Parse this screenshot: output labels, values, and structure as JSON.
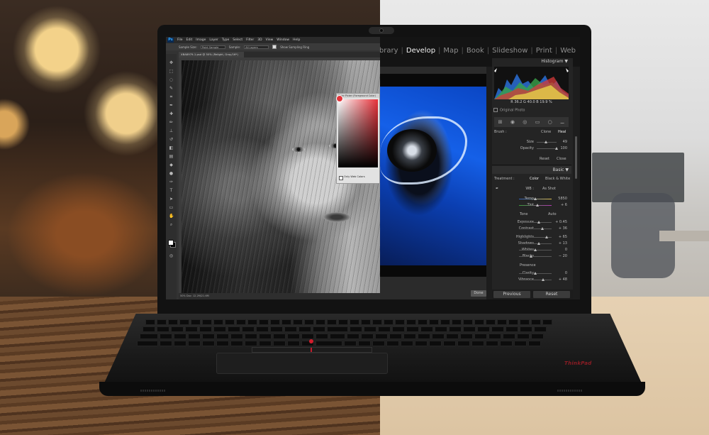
{
  "photoshop": {
    "logo": "Ps",
    "menus": [
      "File",
      "Edit",
      "Image",
      "Layer",
      "Type",
      "Select",
      "Filter",
      "3D",
      "View",
      "Window",
      "Help"
    ],
    "options": {
      "sample_size_label": "Sample Size:",
      "sample_size_value": "Point Sample",
      "sample_label": "Sample:",
      "sample_value": "All Layers",
      "sampling_ring_label": "Show Sampling Ring"
    },
    "document_tab": "XBA8979-1.psd @ 50% (Relight, Gray/16*)",
    "status_text": "50%          Doc: 12.2M/21.6M",
    "color_picker": {
      "title": "Color Picker (Foreground Color)",
      "only_web_colors_label": "Only Web Colors"
    }
  },
  "lightroom": {
    "modules": [
      "Library",
      "Develop",
      "Map",
      "Book",
      "Slideshow",
      "Print",
      "Web"
    ],
    "active_module": "Develop",
    "histogram": {
      "title": "Histogram",
      "readout": "R  36.2  G  40.0  B  19.9 %"
    },
    "original_photo_label": "Original Photo",
    "brush": {
      "label": "Brush :",
      "clone": "Clone",
      "heal": "Heal",
      "size_label": "Size",
      "size_value": "49",
      "opacity_label": "Opacity",
      "opacity_value": "100",
      "reset": "Reset",
      "close": "Close"
    },
    "basic": {
      "title": "Basic",
      "treatment_label": "Treatment :",
      "color": "Color",
      "bw": "Black & White",
      "wb_label": "WB :",
      "wb_value": "As Shot",
      "temp_label": "Temp",
      "temp_value": "5850",
      "tint_label": "Tint",
      "tint_value": "+ 6",
      "tone_label": "Tone",
      "auto_label": "Auto",
      "exposure_label": "Exposure",
      "exposure_value": "+ 0.45",
      "contrast_label": "Contrast",
      "contrast_value": "+ 36",
      "highlights_label": "Highlights",
      "highlights_value": "+ 65",
      "shadows_label": "Shadows",
      "shadows_value": "+ 13",
      "whites_label": "Whites",
      "whites_value": "0",
      "blacks_label": "Blacks",
      "blacks_value": "− 20",
      "presence_label": "Presence",
      "clarity_label": "Clarity",
      "clarity_value": "0",
      "vibrance_label": "Vibrance",
      "vibrance_value": "+ 48"
    },
    "done_button": "Done",
    "previous_button": "Previous",
    "reset_button": "Reset"
  },
  "laptop": {
    "brand": "ThinkPad"
  },
  "colors": {
    "trackpoint_red": "#d11d2d",
    "photo_blue": "#1560e8",
    "picker_red": "#e8323a"
  }
}
